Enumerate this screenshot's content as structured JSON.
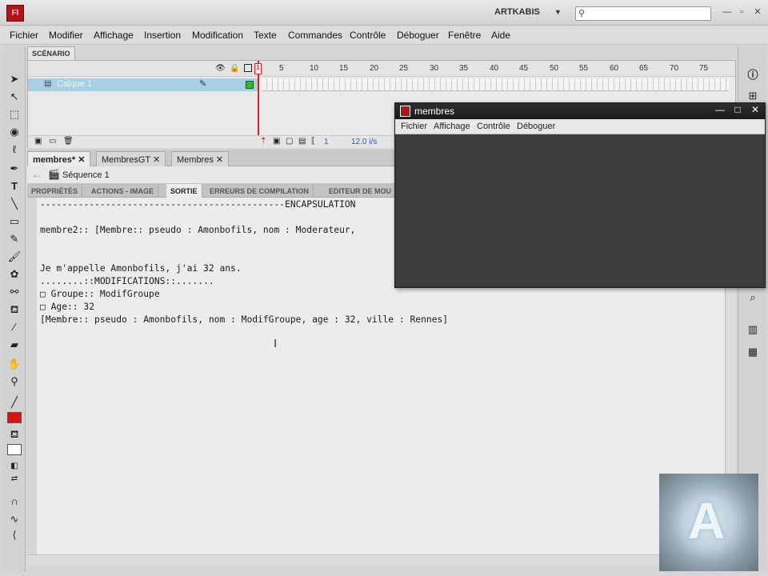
{
  "app": {
    "logo": "Fl",
    "workspace": "ARTKABIS"
  },
  "menubar": [
    "Fichier",
    "Modifier",
    "Affichage",
    "Insertion",
    "Modification",
    "Texte",
    "Commandes",
    "Contrôle",
    "Déboguer",
    "Fenêtre",
    "Aide"
  ],
  "timeline": {
    "tab": "SCÉNARIO",
    "frame_numbers": [
      "5",
      "10",
      "15",
      "20",
      "25",
      "30",
      "35",
      "40",
      "45",
      "50",
      "55",
      "60",
      "65",
      "70",
      "75"
    ],
    "layer_name": "Calque 1",
    "current_frame": "1",
    "fps": "12.0 i/s",
    "playhead_label": "1"
  },
  "doc_tabs": [
    "membres*",
    "MembresGT",
    "Membres"
  ],
  "editbar": {
    "scene": "Séquence 1"
  },
  "panel_tabs": [
    "PROPRIÉTÉS",
    "ACTIONS - IMAGE",
    "SORTIE",
    "ERREURS DE COMPILATION",
    "EDITEUR DE MOU"
  ],
  "output_lines": [
    "---------------------------------------------ENCAPSULATION",
    "",
    "membre2:: [Membre:: pseudo : Amonbofils, nom : Moderateur,",
    "",
    "",
    "Je m'appelle Amonbofils, j'ai 32 ans.",
    "........::MODIFICATIONS::.......",
    "□ Groupe:: ModifGroupe",
    "□ Age:: 32",
    "[Membre:: pseudo : Amonbofils, nom : ModifGroupe, age : 32, ville : Rennes]"
  ],
  "player": {
    "title": "membres",
    "menu": [
      "Fichier",
      "Affichage",
      "Contrôle",
      "Déboguer"
    ]
  },
  "icons": {
    "search": "search-icon",
    "cursor": "text-cursor-icon"
  },
  "colors": {
    "accent_red": "#e01010",
    "layer_highlight": "#a9cfe3",
    "player_bg": "#3a3a3a"
  }
}
